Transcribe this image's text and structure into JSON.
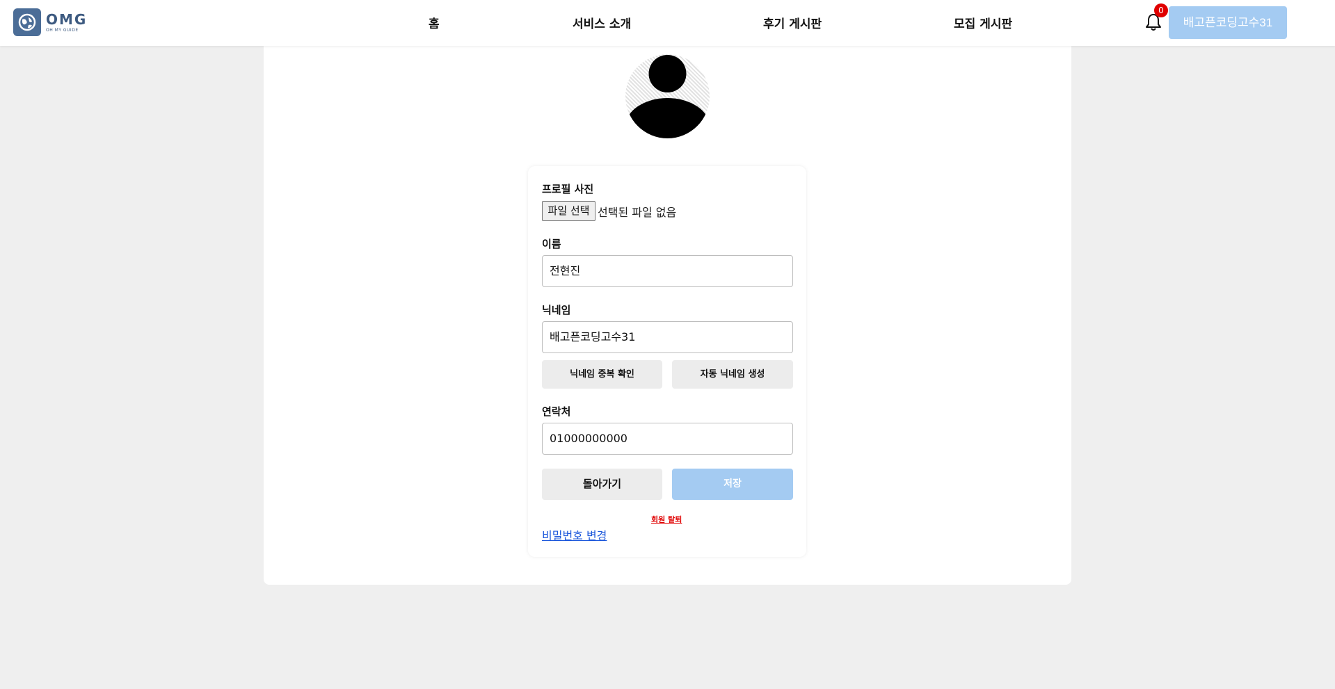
{
  "header": {
    "logo_text": "OMG",
    "logo_subtext": "OH MY GUIDE",
    "nav": [
      {
        "label": "홈"
      },
      {
        "label": "서비스 소개"
      },
      {
        "label": "후기 게시판"
      },
      {
        "label": "모집 게시판"
      }
    ],
    "notification_count": "0",
    "user_button_label": "배고픈코딩고수31"
  },
  "profile_form": {
    "photo_label": "프로필 사진",
    "file_button_label": "파일 선택",
    "file_status": "선택된 파일 없음",
    "name_label": "이름",
    "name_value": "전현진",
    "nickname_label": "닉네임",
    "nickname_value": "배고픈코딩고수31",
    "check_duplicate_label": "닉네임 중복 확인",
    "auto_generate_label": "자동 닉네임 생성",
    "contact_label": "연락처",
    "contact_value": "01000000000",
    "back_label": "돌아가기",
    "save_label": "저장",
    "withdraw_label": "회원 탈퇴",
    "change_password_label": "비밀번호 변경"
  },
  "colors": {
    "accent_light_blue": "#a4cbf2",
    "danger_red": "#e00000",
    "link_blue": "#1a56db",
    "brand_navy": "#3d5a80"
  }
}
